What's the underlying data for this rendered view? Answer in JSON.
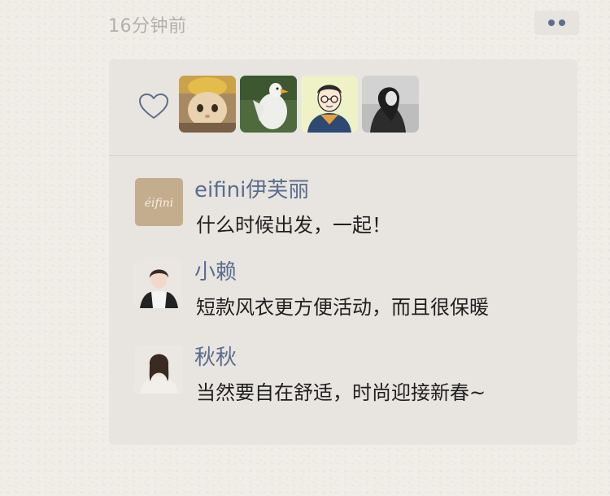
{
  "post": {
    "timestamp": "16分钟前"
  },
  "actions": {
    "more_icon": "more-dots-icon"
  },
  "likes": {
    "heart_icon": "heart-outline-icon",
    "avatars": [
      {
        "name": "cat-avatar"
      },
      {
        "name": "duck-avatar"
      },
      {
        "name": "cartoon-boy-avatar"
      },
      {
        "name": "girl-photo-avatar"
      }
    ]
  },
  "comments": [
    {
      "name": "eifini伊芙丽",
      "avatar_text": "éifini",
      "text": "什么时候出发，一起！"
    },
    {
      "name": "小赖",
      "text": "短款风衣更方便活动，而且很保暖"
    },
    {
      "name": "秋秋",
      "text": "当然要自在舒适，时尚迎接新春~"
    }
  ],
  "colors": {
    "name_color": "#5b6d8c",
    "card_bg": "#e8e4e0",
    "page_bg": "#f1eee8"
  }
}
